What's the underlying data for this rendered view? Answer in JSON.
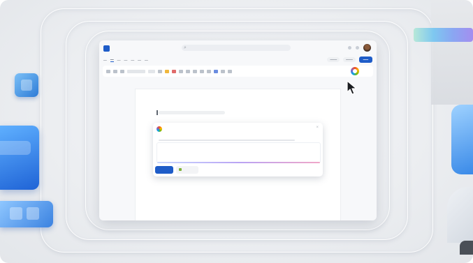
{
  "app": {
    "title": "",
    "search_placeholder": "",
    "brand_color": "#1e5cc8"
  },
  "menubar": {
    "items": [
      "",
      "",
      "",
      "",
      "",
      "",
      ""
    ],
    "selected_index": 1,
    "share_label": ""
  },
  "ribbon": {
    "copilot_button": {
      "icon": "copilot-icon"
    }
  },
  "document": {
    "heading": ""
  },
  "copilot_dialog": {
    "title": "",
    "prompt_text": "",
    "generate_label": "",
    "reference_label": ""
  },
  "cursor": {
    "icon": "mouse-pointer-icon"
  },
  "decor": {
    "icons": [
      "word-app-icon",
      "outlook-app-icon",
      "cloud-app-icon"
    ]
  }
}
